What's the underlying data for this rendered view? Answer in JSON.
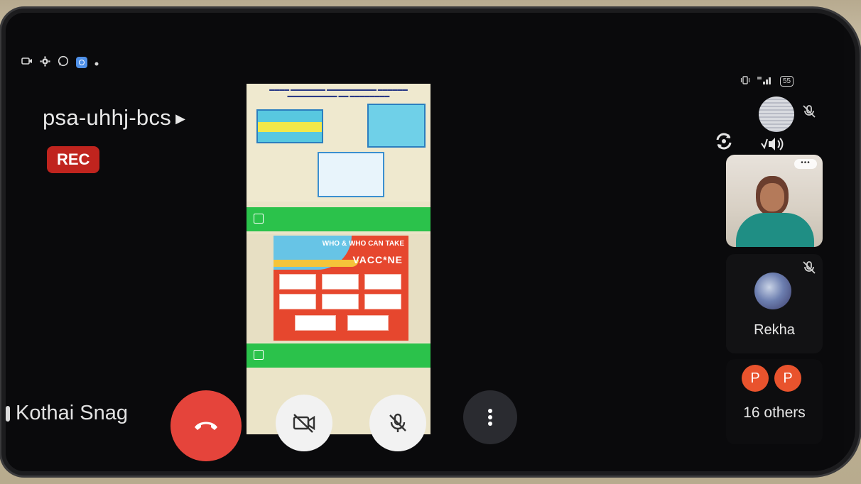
{
  "meeting": {
    "code": "psa-uhhj-bcs",
    "rec_badge": "REC",
    "presenter_name": "Kothai Snag"
  },
  "status_bar": {
    "left_icons": [
      "camera-icon",
      "gear-icon",
      "whatsapp-icon",
      "app-icon",
      "dot-icon"
    ],
    "battery": "55"
  },
  "participants": {
    "rekha_name": "Rekha",
    "badges": [
      "P",
      "P"
    ],
    "others_label": "16 others"
  },
  "shared_slide": {
    "poster_heading": "WHO & WHO CAN TAKE",
    "poster_title": "VACC*NE"
  },
  "controls": {
    "end_call": "end-call-icon",
    "camera": "camera-off-icon",
    "mic": "mic-off-icon",
    "more": "more-vertical-icon"
  },
  "colors": {
    "end_call": "#e5443b",
    "rec": "#c0241e",
    "avatar_badge": "#e9532d",
    "share_green": "#2bc24b"
  }
}
